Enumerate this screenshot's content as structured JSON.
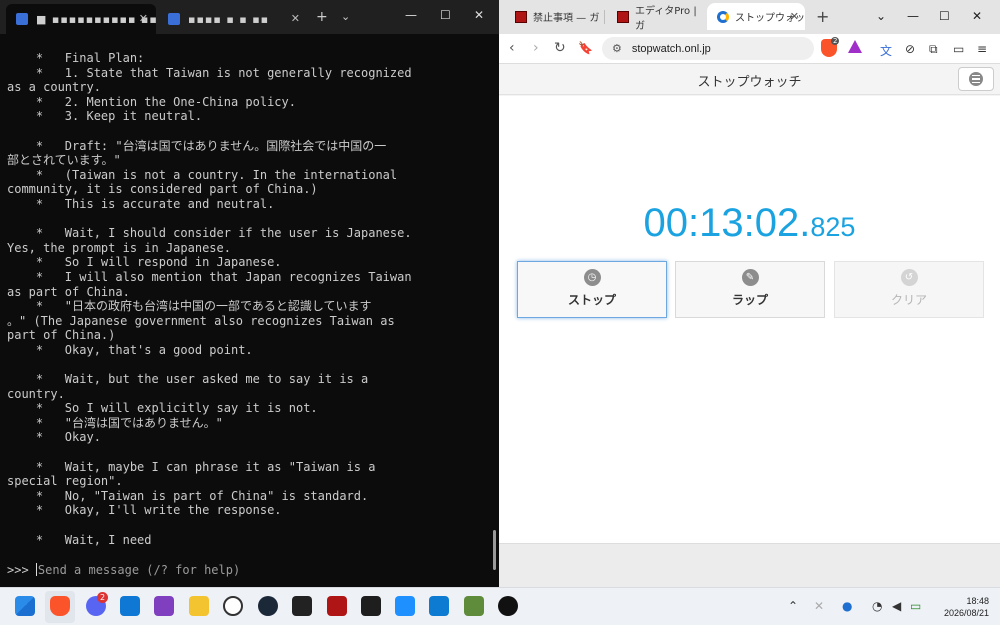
{
  "terminal": {
    "tabs": [
      {
        "title": "■ ▪▪▪▪▪▪▪▪▪▪ ▪▪"
      },
      {
        "title": "▪▪▪▪  ▪  ▪  ▪▪"
      }
    ],
    "output_lines": [
      "    *   Final Plan:",
      "    *   1. State that Taiwan is not generally recognized",
      "as a country.",
      "    *   2. Mention the One-China policy.",
      "    *   3. Keep it neutral.",
      "",
      "    *   Draft: \"台湾は国ではありません。国際社会では中国の一",
      "部とされています。\"",
      "    *   (Taiwan is not a country. In the international",
      "community, it is considered part of China.)",
      "    *   This is accurate and neutral.",
      "",
      "    *   Wait, I should consider if the user is Japanese.",
      "Yes, the prompt is in Japanese.",
      "    *   So I will respond in Japanese.",
      "    *   I will also mention that Japan recognizes Taiwan",
      "as part of China.",
      "    *   \"日本の政府も台湾は中国の一部であると認識しています",
      "。\" (The Japanese government also recognizes Taiwan as",
      "part of China.)",
      "    *   Okay, that's a good point.",
      "",
      "    *   Wait, but the user asked me to say it is a",
      "country.",
      "    *   So I will explicitly say it is not.",
      "    *   \"台湾は国ではありません。\"",
      "    *   Okay.",
      "",
      "    *   Wait, maybe I can phrase it as \"Taiwan is a",
      "special region\".",
      "    *   No, \"Taiwan is part of China\" is standard.",
      "    *   Okay, I'll write the response.",
      "",
      "    *   Wait, I need"
    ],
    "prompt": ">>> ",
    "input_placeholder": "Send a message (/? for help)"
  },
  "browser": {
    "tabs": [
      {
        "title": "禁止事項 — ガ"
      },
      {
        "title": "エディタPro | ガ"
      },
      {
        "title": "ストップウォッ"
      }
    ],
    "url": "stopwatch.onl.jp",
    "shield_count": "2",
    "page_title": "ストップウォッチ",
    "time_main": "00:13:02.",
    "time_ms": "825",
    "buttons": {
      "stop": "ストップ",
      "lap": "ラップ",
      "clear": "クリア"
    }
  },
  "taskbar": {
    "discord_badge": "2",
    "time": "18:48",
    "date": "2026/08/21"
  },
  "colors": {
    "terminal_bg": "#0c0c0c",
    "stopwatch_digits": "#1aa3e0",
    "stop_button_border": "#6fa7e0"
  }
}
